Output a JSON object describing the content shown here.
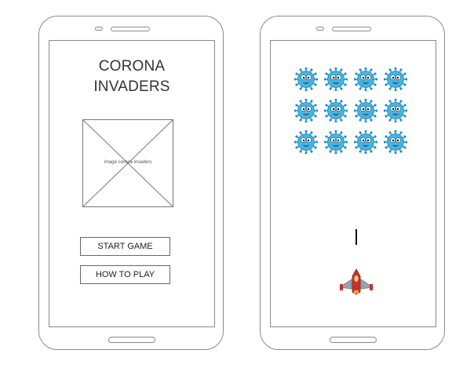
{
  "menu_screen": {
    "title_line1": "CORONA",
    "title_line2": "INVADERS",
    "image_placeholder_label": "image corona invaders",
    "start_button_label": "START GAME",
    "howto_button_label": "HOW TO PLAY"
  },
  "game_screen": {
    "enemy_grid": {
      "rows": 3,
      "columns": 4
    },
    "enemy_icon": "coronavirus-icon",
    "player_icon": "spaceship-icon",
    "projectile_icon": "laser-bullet"
  },
  "colors": {
    "virus_body": "#3fb6e6",
    "virus_spikes": "#1e88c7",
    "ship_body": "#c9302c",
    "ship_wings": "#9aa3ad",
    "outline": "#8a8a8a"
  }
}
